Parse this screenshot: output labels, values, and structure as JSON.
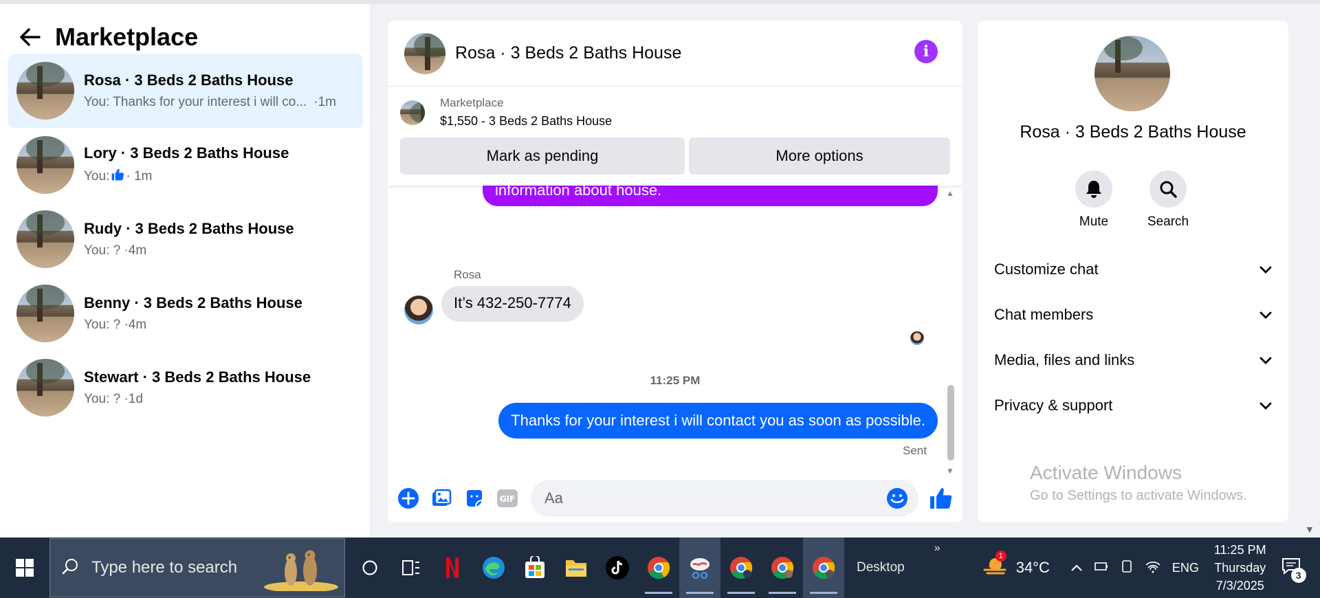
{
  "left": {
    "title": "Marketplace",
    "conversations": [
      {
        "name": "Rosa · 3 Beds 2 Baths House",
        "preview": "You: Thanks for your interest i will co...",
        "time": "·1m",
        "active": true
      },
      {
        "name": "Lory · 3 Beds 2 Baths House",
        "preview_prefix": "You:",
        "preview_suffix": "· 1m"
      },
      {
        "name": "Rudy · 3 Beds 2 Baths House",
        "preview": "You: ? ·4m"
      },
      {
        "name": "Benny · 3 Beds 2 Baths House",
        "preview": "You: ? ·4m"
      },
      {
        "name": "Stewart · 3 Beds 2 Baths House",
        "preview": "You: ? ·1d"
      }
    ]
  },
  "chat": {
    "title": "Rosa · 3 Beds 2 Baths House",
    "listing": {
      "label": "Marketplace",
      "price": "$1,550 - 3 Beds 2 Baths House"
    },
    "buttons": {
      "pending": "Mark as pending",
      "more": "More options"
    },
    "messages": {
      "partial_outgoing": "information about house.",
      "sender_name": "Rosa",
      "incoming": "It’s 432-250-7774",
      "timestamp": "11:25 PM",
      "outgoing": "Thanks for your interest i will contact you as soon as possible.",
      "status": "Sent"
    },
    "composer": {
      "placeholder": "Aa"
    },
    "accent_blue": "#0866ff",
    "accent_purple": "#a40eff"
  },
  "profile": {
    "name": "Rosa · 3 Beds 2 Baths House",
    "actions": {
      "mute": "Mute",
      "search": "Search"
    },
    "sections": [
      "Customize chat",
      "Chat members",
      "Media, files and links",
      "Privacy & support"
    ],
    "watermark": {
      "title": "Activate Windows",
      "subtitle": "Go to Settings to activate Windows."
    }
  },
  "taskbar": {
    "search_placeholder": "Type here to search",
    "desktop_label": "Desktop",
    "weather": {
      "temp": "34°C",
      "badge": "1"
    },
    "language": "ENG",
    "clock": {
      "time": "11:25 PM",
      "day": "Thursday",
      "date": "7/3/2025"
    },
    "notifications": "3",
    "icons": [
      "windows-icon",
      "search-icon",
      "cortana-icon",
      "task-view-icon",
      "netflix-icon",
      "edge-icon",
      "store-icon",
      "file-explorer-icon",
      "tiktok-icon",
      "chrome-icon",
      "snipping-tool-icon",
      "chrome-profile-icon"
    ]
  }
}
